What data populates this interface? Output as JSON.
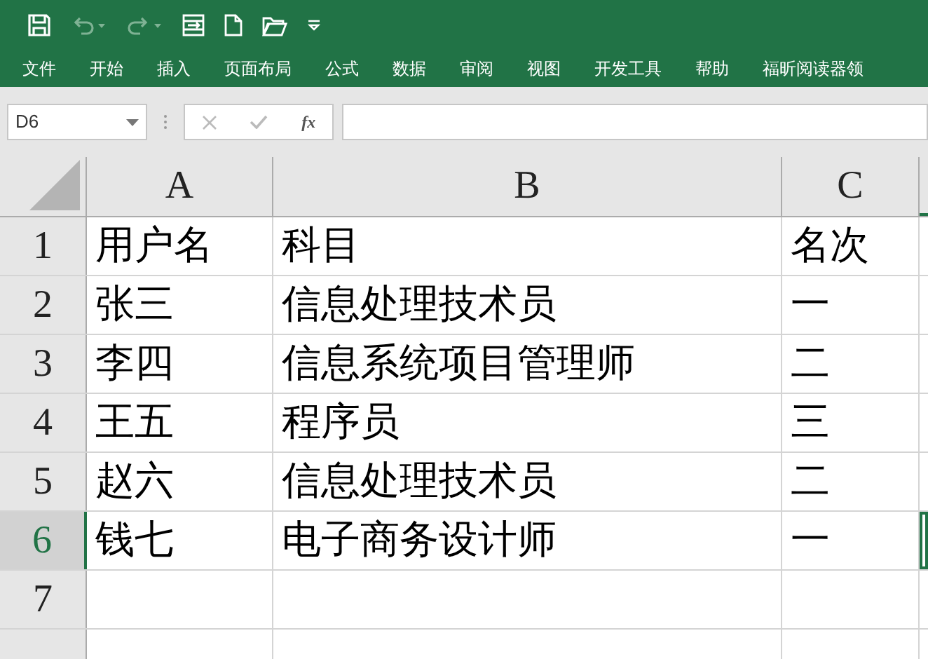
{
  "ribbon_tabs": [
    "文件",
    "开始",
    "插入",
    "页面布局",
    "公式",
    "数据",
    "审阅",
    "视图",
    "开发工具",
    "帮助",
    "福昕阅读器领"
  ],
  "name_box": {
    "value": "D6"
  },
  "formula_bar": {
    "function_label": "fx"
  },
  "columns": [
    {
      "label": "A",
      "selected": false
    },
    {
      "label": "B",
      "selected": false
    },
    {
      "label": "C",
      "selected": false
    }
  ],
  "rows": [
    {
      "number": "1",
      "selected": false,
      "cells": [
        "用户名",
        "科目",
        "名次"
      ]
    },
    {
      "number": "2",
      "selected": false,
      "cells": [
        "张三",
        "信息处理技术员",
        "一"
      ]
    },
    {
      "number": "3",
      "selected": false,
      "cells": [
        "李四",
        "信息系统项目管理师",
        "二"
      ]
    },
    {
      "number": "4",
      "selected": false,
      "cells": [
        "王五",
        "程序员",
        "三"
      ]
    },
    {
      "number": "5",
      "selected": false,
      "cells": [
        "赵六",
        "信息处理技术员",
        "二"
      ]
    },
    {
      "number": "6",
      "selected": true,
      "cells": [
        "钱七",
        "电子商务设计师",
        "一"
      ]
    },
    {
      "number": "7",
      "selected": false,
      "cells": [
        "",
        "",
        ""
      ]
    },
    {
      "selected": false,
      "cells": [
        "",
        "",
        ""
      ]
    }
  ]
}
